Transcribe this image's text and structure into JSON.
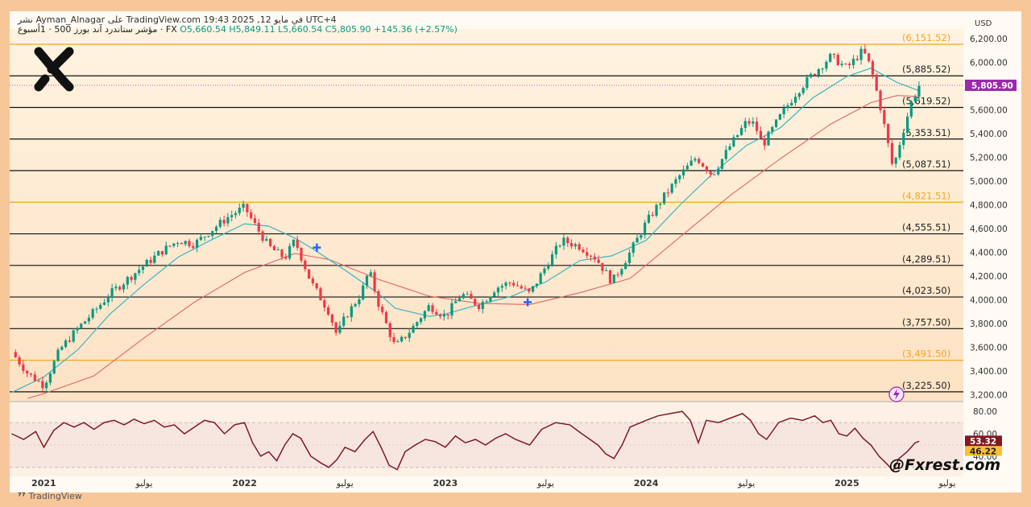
{
  "header": {
    "publisher_line": "نشر Ayman_Alnagar على TradingView.com في مايو 12, 2025 19:43 UTC+4",
    "symbol_line": "مؤشر ستاندرد آند بورز 500 · 1أسبوع · FX",
    "ohlc": {
      "open": "O5,660.54",
      "high": "H5,849.11",
      "low": "L5,660.54",
      "close": "C5,805.90",
      "change": "+145.36 (+2.57%)"
    },
    "currency": "USD"
  },
  "watermark": "@Fxrest.com",
  "footer": "TradingView",
  "colors": {
    "up": "#089981",
    "down": "#f23645",
    "ma_fast": "#3bb3c3",
    "ma_slow": "#e06666",
    "fib_orange": "#f5a623",
    "rsi_line": "#801922",
    "price_tag": "#9c27b0"
  },
  "chart_data": [
    {
      "type": "candlestick",
      "title": "",
      "ylim": [
        3150,
        6280
      ],
      "y_axis_ticks": [
        "6,200.00",
        "6,000.00",
        "5,800.00",
        "5,600.00",
        "5,400.00",
        "5,200.00",
        "5,000.00",
        "4,800.00",
        "4,600.00",
        "4,400.00",
        "4,200.00",
        "4,000.00",
        "3,800.00",
        "3,600.00",
        "3,400.00",
        "3,200.00"
      ],
      "y_tick_values": [
        6200,
        6000,
        5800,
        5600,
        5400,
        5200,
        5000,
        4800,
        4600,
        4400,
        4200,
        4000,
        3800,
        3600,
        3400,
        3200
      ],
      "x_axis_ticks": [
        {
          "label": "2021",
          "t": 2021.0
        },
        {
          "label": "يوليو",
          "t": 2021.5
        },
        {
          "label": "2022",
          "t": 2022.0
        },
        {
          "label": "يوليو",
          "t": 2022.5
        },
        {
          "label": "2023",
          "t": 2023.0
        },
        {
          "label": "يوليو",
          "t": 2023.5
        },
        {
          "label": "2024",
          "t": 2024.0
        },
        {
          "label": "يوليو",
          "t": 2024.5
        },
        {
          "label": "2025",
          "t": 2025.0
        },
        {
          "label": "يوليو",
          "t": 2025.5
        }
      ],
      "x_range": [
        2020.83,
        2025.58
      ],
      "last_price": "5,805.90",
      "last_price_value": 5805.9,
      "levels": [
        {
          "label": "(6,151.52)",
          "value": 6151.52,
          "style": "orange"
        },
        {
          "label": "(5,885.52)",
          "value": 5885.52,
          "style": "black"
        },
        {
          "label": "(5,619.52)",
          "value": 5619.52,
          "style": "black"
        },
        {
          "label": "(5,353.51)",
          "value": 5353.51,
          "style": "black"
        },
        {
          "label": "(5,087.51)",
          "value": 5087.51,
          "style": "black"
        },
        {
          "label": "(4,821.51)",
          "value": 4821.51,
          "style": "orange"
        },
        {
          "label": "(4,555.51)",
          "value": 4555.51,
          "style": "black"
        },
        {
          "label": "(4,289.51)",
          "value": 4289.51,
          "style": "black"
        },
        {
          "label": "(4,023.50)",
          "value": 4023.5,
          "style": "black"
        },
        {
          "label": "(3,757.50)",
          "value": 3757.5,
          "style": "black"
        },
        {
          "label": "(3,491.50)",
          "value": 3491.5,
          "style": "orange"
        },
        {
          "label": "(3,225.50)",
          "value": 3225.5,
          "style": "black"
        }
      ],
      "close_path": [
        [
          2020.84,
          3560
        ],
        [
          2020.92,
          3380
        ],
        [
          2021.0,
          3280
        ],
        [
          2021.08,
          3580
        ],
        [
          2021.17,
          3760
        ],
        [
          2021.25,
          3900
        ],
        [
          2021.33,
          4050
        ],
        [
          2021.42,
          4180
        ],
        [
          2021.5,
          4290
        ],
        [
          2021.58,
          4400
        ],
        [
          2021.67,
          4500
        ],
        [
          2021.75,
          4470
        ],
        [
          2021.83,
          4580
        ],
        [
          2021.92,
          4700
        ],
        [
          2022.0,
          4780
        ],
        [
          2022.04,
          4660
        ],
        [
          2022.12,
          4450
        ],
        [
          2022.2,
          4350
        ],
        [
          2022.25,
          4500
        ],
        [
          2022.33,
          4150
        ],
        [
          2022.42,
          3900
        ],
        [
          2022.46,
          3700
        ],
        [
          2022.5,
          3850
        ],
        [
          2022.58,
          4050
        ],
        [
          2022.62,
          4250
        ],
        [
          2022.67,
          3950
        ],
        [
          2022.75,
          3600
        ],
        [
          2022.83,
          3750
        ],
        [
          2022.92,
          3950
        ],
        [
          2023.0,
          3860
        ],
        [
          2023.08,
          4050
        ],
        [
          2023.17,
          3950
        ],
        [
          2023.25,
          4100
        ],
        [
          2023.33,
          4150
        ],
        [
          2023.42,
          4050
        ],
        [
          2023.5,
          4280
        ],
        [
          2023.58,
          4500
        ],
        [
          2023.67,
          4450
        ],
        [
          2023.75,
          4350
        ],
        [
          2023.83,
          4150
        ],
        [
          2023.92,
          4400
        ],
        [
          2024.0,
          4650
        ],
        [
          2024.08,
          4850
        ],
        [
          2024.17,
          5050
        ],
        [
          2024.25,
          5200
        ],
        [
          2024.33,
          5050
        ],
        [
          2024.42,
          5300
        ],
        [
          2024.5,
          5500
        ],
        [
          2024.54,
          5480
        ],
        [
          2024.58,
          5300
        ],
        [
          2024.67,
          5550
        ],
        [
          2024.75,
          5750
        ],
        [
          2024.83,
          5900
        ],
        [
          2024.92,
          6050
        ],
        [
          2025.0,
          5950
        ],
        [
          2025.08,
          6100
        ],
        [
          2025.12,
          5950
        ],
        [
          2025.17,
          5600
        ],
        [
          2025.23,
          5100
        ],
        [
          2025.26,
          5300
        ],
        [
          2025.32,
          5660
        ],
        [
          2025.36,
          5805.9
        ]
      ],
      "ma_fast_path": [
        [
          2020.84,
          3220
        ],
        [
          2021.0,
          3350
        ],
        [
          2021.17,
          3580
        ],
        [
          2021.33,
          3880
        ],
        [
          2021.5,
          4130
        ],
        [
          2021.67,
          4360
        ],
        [
          2021.83,
          4500
        ],
        [
          2022.0,
          4640
        ],
        [
          2022.12,
          4620
        ],
        [
          2022.25,
          4520
        ],
        [
          2022.33,
          4440
        ],
        [
          2022.5,
          4250
        ],
        [
          2022.67,
          4050
        ],
        [
          2022.75,
          3930
        ],
        [
          2022.92,
          3860
        ],
        [
          2023.0,
          3880
        ],
        [
          2023.17,
          3960
        ],
        [
          2023.33,
          4030
        ],
        [
          2023.5,
          4150
        ],
        [
          2023.67,
          4330
        ],
        [
          2023.83,
          4370
        ],
        [
          2024.0,
          4500
        ],
        [
          2024.17,
          4800
        ],
        [
          2024.33,
          5060
        ],
        [
          2024.5,
          5300
        ],
        [
          2024.67,
          5450
        ],
        [
          2024.83,
          5700
        ],
        [
          2025.0,
          5880
        ],
        [
          2025.12,
          5950
        ],
        [
          2025.25,
          5830
        ],
        [
          2025.36,
          5760
        ]
      ],
      "ma_slow_path": [
        [
          2020.92,
          3170
        ],
        [
          2021.0,
          3210
        ],
        [
          2021.25,
          3360
        ],
        [
          2021.5,
          3680
        ],
        [
          2021.75,
          3980
        ],
        [
          2022.0,
          4230
        ],
        [
          2022.25,
          4390
        ],
        [
          2022.42,
          4340
        ],
        [
          2022.67,
          4170
        ],
        [
          2022.92,
          4030
        ],
        [
          2023.17,
          3970
        ],
        [
          2023.42,
          3960
        ],
        [
          2023.67,
          4060
        ],
        [
          2023.92,
          4180
        ],
        [
          2024.17,
          4530
        ],
        [
          2024.42,
          4880
        ],
        [
          2024.67,
          5190
        ],
        [
          2024.92,
          5480
        ],
        [
          2025.12,
          5660
        ],
        [
          2025.25,
          5720
        ],
        [
          2025.36,
          5710
        ]
      ],
      "markers": [
        {
          "t": 2022.36,
          "value": 4440
        },
        {
          "t": 2023.41,
          "value": 3980
        }
      ]
    },
    {
      "type": "line",
      "title": "",
      "ylim": [
        22,
        88
      ],
      "y_axis_ticks": [
        "80.00",
        "60.00",
        "40.00"
      ],
      "y_tick_values": [
        80,
        60,
        40
      ],
      "band": [
        30,
        70
      ],
      "last_value": "53.32",
      "last_value_num": 53.32,
      "secondary_value": "46.22",
      "secondary_value_num": 46.22,
      "rsi_path": [
        [
          2020.84,
          60
        ],
        [
          2020.9,
          55
        ],
        [
          2020.96,
          62
        ],
        [
          2021.0,
          48
        ],
        [
          2021.05,
          63
        ],
        [
          2021.1,
          70
        ],
        [
          2021.15,
          66
        ],
        [
          2021.2,
          70
        ],
        [
          2021.25,
          64
        ],
        [
          2021.3,
          70
        ],
        [
          2021.35,
          72
        ],
        [
          2021.4,
          68
        ],
        [
          2021.45,
          73
        ],
        [
          2021.5,
          69
        ],
        [
          2021.55,
          72
        ],
        [
          2021.6,
          66
        ],
        [
          2021.65,
          68
        ],
        [
          2021.7,
          60
        ],
        [
          2021.75,
          66
        ],
        [
          2021.8,
          72
        ],
        [
          2021.85,
          70
        ],
        [
          2021.9,
          60
        ],
        [
          2021.95,
          68
        ],
        [
          2022.0,
          70
        ],
        [
          2022.04,
          52
        ],
        [
          2022.08,
          40
        ],
        [
          2022.12,
          44
        ],
        [
          2022.16,
          36
        ],
        [
          2022.2,
          50
        ],
        [
          2022.24,
          60
        ],
        [
          2022.28,
          56
        ],
        [
          2022.33,
          40
        ],
        [
          2022.38,
          34
        ],
        [
          2022.42,
          30
        ],
        [
          2022.46,
          37
        ],
        [
          2022.5,
          48
        ],
        [
          2022.55,
          44
        ],
        [
          2022.6,
          55
        ],
        [
          2022.64,
          62
        ],
        [
          2022.68,
          48
        ],
        [
          2022.72,
          32
        ],
        [
          2022.76,
          28
        ],
        [
          2022.8,
          44
        ],
        [
          2022.85,
          50
        ],
        [
          2022.9,
          55
        ],
        [
          2022.95,
          53
        ],
        [
          2023.0,
          48
        ],
        [
          2023.05,
          58
        ],
        [
          2023.1,
          52
        ],
        [
          2023.15,
          55
        ],
        [
          2023.2,
          50
        ],
        [
          2023.25,
          56
        ],
        [
          2023.3,
          60
        ],
        [
          2023.35,
          55
        ],
        [
          2023.42,
          50
        ],
        [
          2023.48,
          64
        ],
        [
          2023.55,
          70
        ],
        [
          2023.62,
          68
        ],
        [
          2023.68,
          60
        ],
        [
          2023.72,
          55
        ],
        [
          2023.76,
          50
        ],
        [
          2023.8,
          42
        ],
        [
          2023.84,
          38
        ],
        [
          2023.88,
          50
        ],
        [
          2023.92,
          66
        ],
        [
          2024.0,
          72
        ],
        [
          2024.06,
          76
        ],
        [
          2024.12,
          78
        ],
        [
          2024.18,
          80
        ],
        [
          2024.22,
          72
        ],
        [
          2024.26,
          52
        ],
        [
          2024.3,
          72
        ],
        [
          2024.36,
          70
        ],
        [
          2024.42,
          74
        ],
        [
          2024.48,
          78
        ],
        [
          2024.52,
          72
        ],
        [
          2024.56,
          60
        ],
        [
          2024.6,
          55
        ],
        [
          2024.66,
          70
        ],
        [
          2024.72,
          74
        ],
        [
          2024.78,
          72
        ],
        [
          2024.84,
          76
        ],
        [
          2024.88,
          70
        ],
        [
          2024.92,
          72
        ],
        [
          2024.96,
          60
        ],
        [
          2025.0,
          58
        ],
        [
          2025.04,
          65
        ],
        [
          2025.08,
          56
        ],
        [
          2025.12,
          50
        ],
        [
          2025.16,
          40
        ],
        [
          2025.2,
          33
        ],
        [
          2025.23,
          27
        ],
        [
          2025.26,
          38
        ],
        [
          2025.3,
          44
        ],
        [
          2025.34,
          52
        ],
        [
          2025.36,
          53.32
        ]
      ]
    }
  ]
}
